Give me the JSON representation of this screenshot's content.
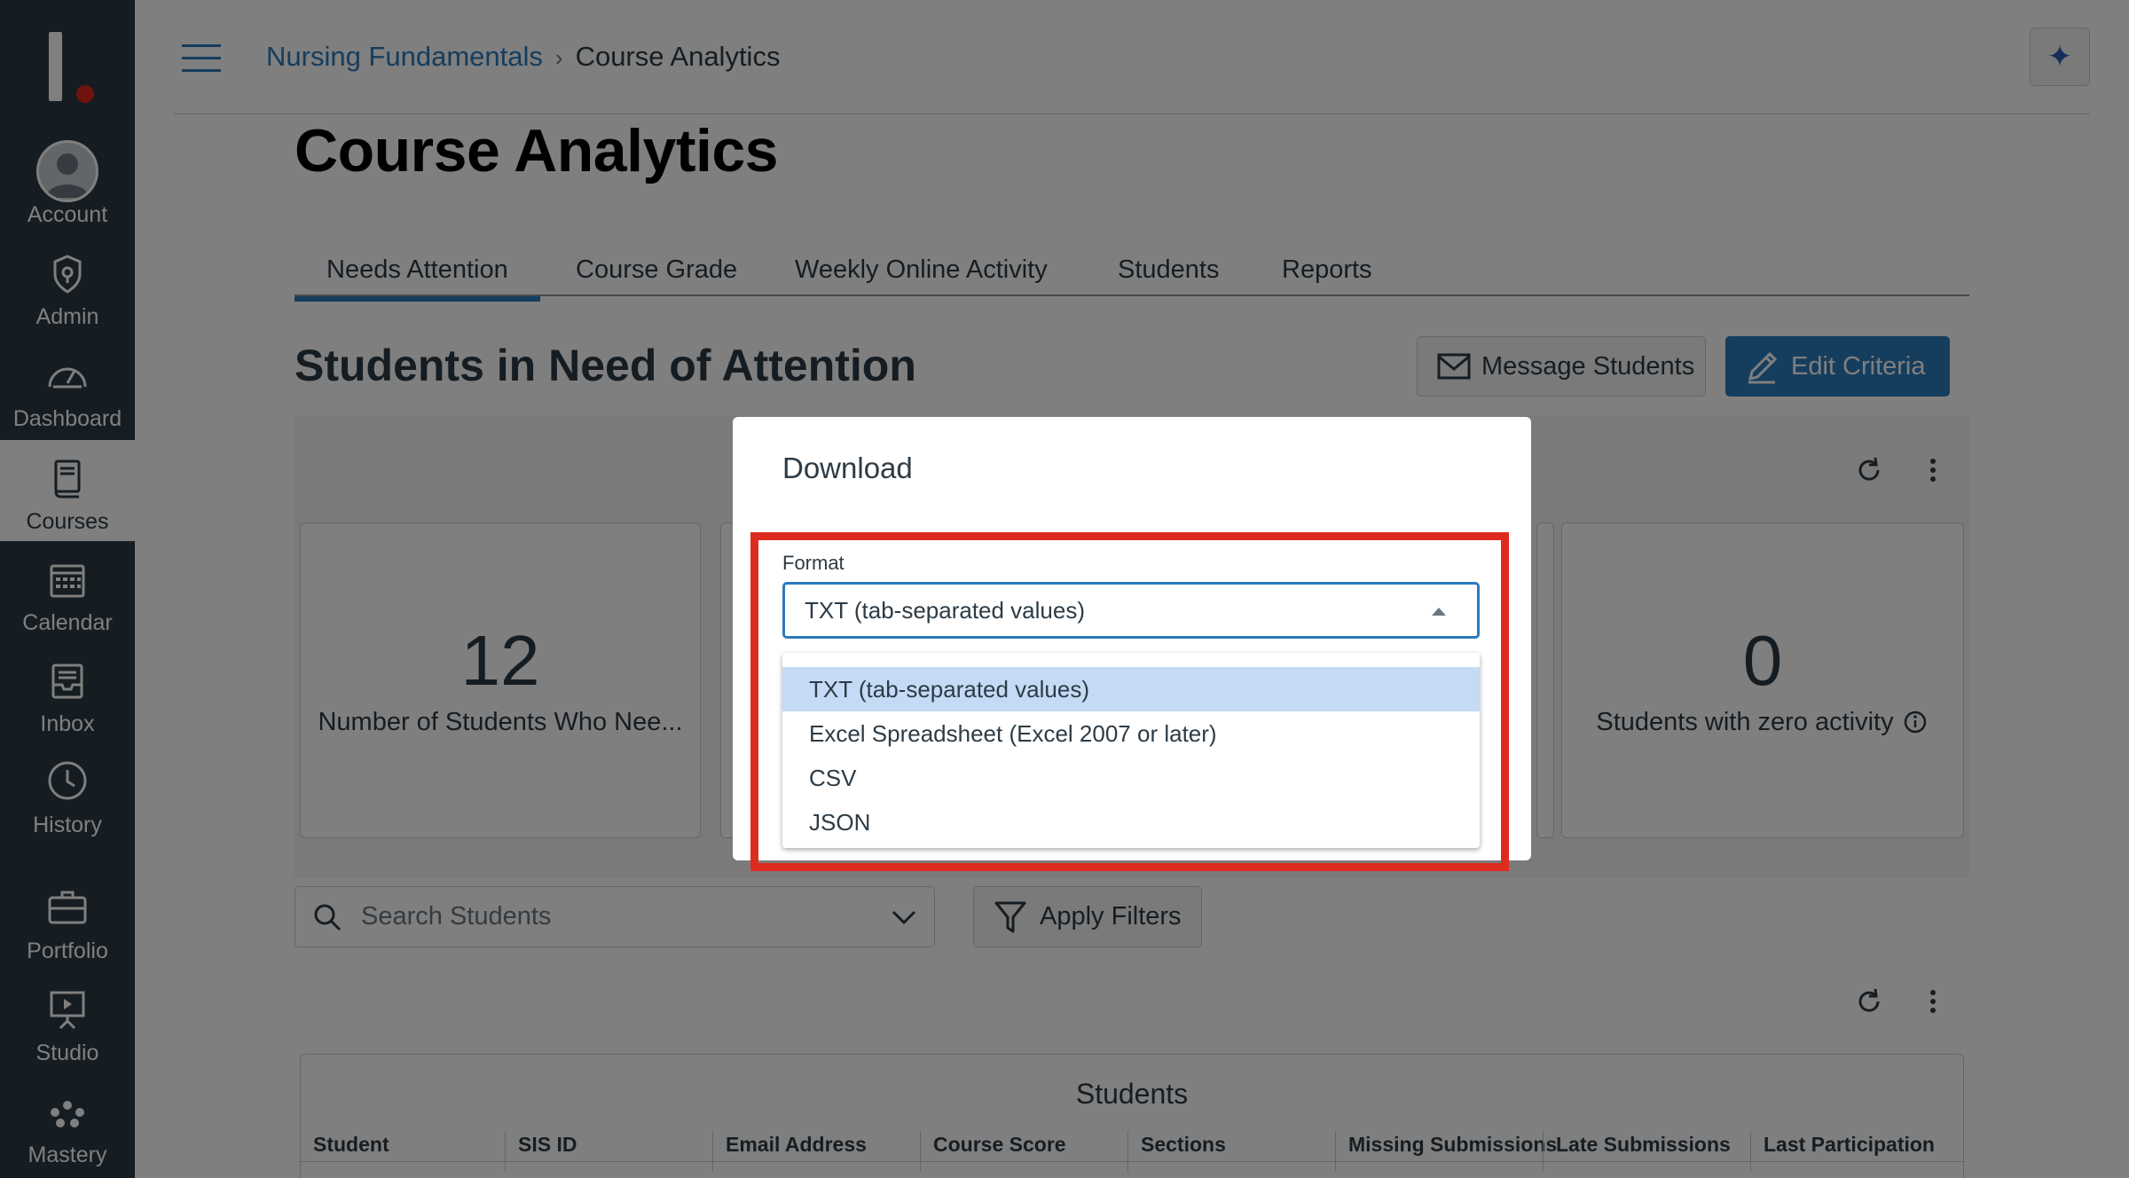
{
  "nav": {
    "items": [
      {
        "label": "Account",
        "icon": "avatar-icon"
      },
      {
        "label": "Admin",
        "icon": "shield-icon"
      },
      {
        "label": "Dashboard",
        "icon": "gauge-icon"
      },
      {
        "label": "Courses",
        "icon": "book-icon"
      },
      {
        "label": "Calendar",
        "icon": "calendar-icon"
      },
      {
        "label": "Inbox",
        "icon": "inbox-icon"
      },
      {
        "label": "History",
        "icon": "clock-icon"
      },
      {
        "label": "Portfolio",
        "icon": "briefcase-icon"
      },
      {
        "label": "Studio",
        "icon": "presentation-icon"
      },
      {
        "label": "Mastery",
        "icon": "dots-icon"
      }
    ],
    "active": "Courses"
  },
  "header": {
    "breadcrumb": [
      {
        "label": "Nursing Fundamentals"
      },
      {
        "label": "Course Analytics"
      }
    ],
    "breadcrumb_separator": "›"
  },
  "page": {
    "title": "Course Analytics",
    "tabs": [
      {
        "label": "Needs Attention"
      },
      {
        "label": "Course Grade"
      },
      {
        "label": "Weekly Online Activity"
      },
      {
        "label": "Students"
      },
      {
        "label": "Reports"
      }
    ],
    "active_tab": "Needs Attention",
    "section_title": "Students in Need of Attention",
    "message_button": "Message Students",
    "edit_button": "Edit Criteria"
  },
  "metrics": {
    "cards": [
      {
        "value": "12",
        "caption": "Number of Students Who Nee..."
      },
      {
        "value": "0",
        "caption": "Students with zero activity"
      }
    ]
  },
  "filters": {
    "search_placeholder": "Search Students",
    "apply_button": "Apply Filters"
  },
  "table": {
    "caption": "Students",
    "columns": [
      "Student",
      "SIS ID",
      "Email Address",
      "Course Score",
      "Sections",
      "Missing Submissions",
      "Late Submissions",
      "Last Participation"
    ]
  },
  "modal": {
    "title": "Download",
    "field_label": "Format",
    "selected": "TXT (tab-separated values)",
    "options": [
      "TXT (tab-separated values)",
      "Excel Spreadsheet (Excel 2007 or later)",
      "CSV",
      "JSON"
    ]
  },
  "colors": {
    "nav_bg": "#2d3b45",
    "brand_accent": "#2b7abc",
    "logo_dot": "#e0261d",
    "highlight_border": "#dd2c1e",
    "selected_option": "#c4daf5"
  }
}
